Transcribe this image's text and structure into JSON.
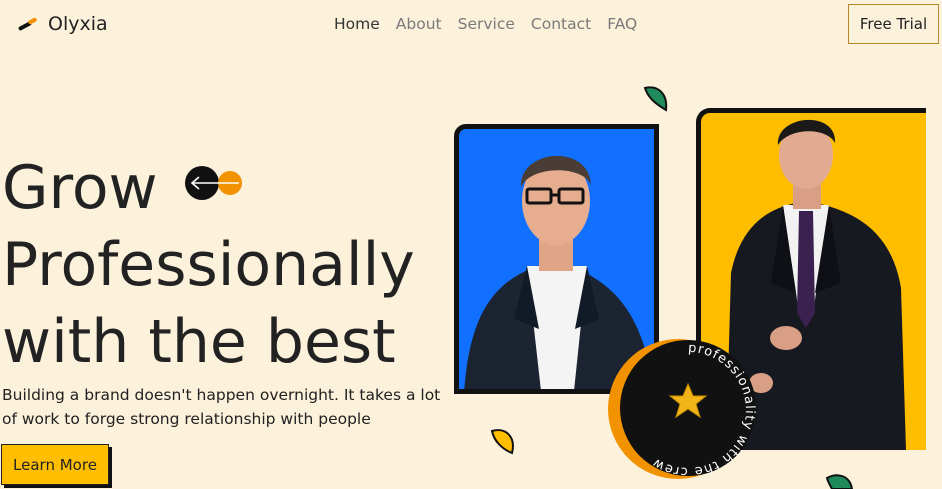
{
  "brand": {
    "name": "Olyxia",
    "logo_icon": "olyxia-logo-icon"
  },
  "nav": {
    "items": [
      {
        "label": "Home",
        "active": true
      },
      {
        "label": "About",
        "active": false
      },
      {
        "label": "Service",
        "active": false
      },
      {
        "label": "Contact",
        "active": false
      },
      {
        "label": "FAQ",
        "active": false
      }
    ],
    "cta_label": "Free Trial"
  },
  "hero": {
    "title_lines": [
      "Grow",
      "Professionally",
      "with the best"
    ],
    "subtitle": "Building a brand doesn't happen overnight. It takes a lot of work to forge strong relationship with people",
    "button_label": "Learn More"
  },
  "badge": {
    "text": "professionality with the crew"
  },
  "colors": {
    "background": "#fcf2dc",
    "accent_yellow": "#ffbd00",
    "accent_blue": "#1170ff",
    "accent_orange": "#f39200",
    "leaf_green": "#1f8a5b"
  }
}
